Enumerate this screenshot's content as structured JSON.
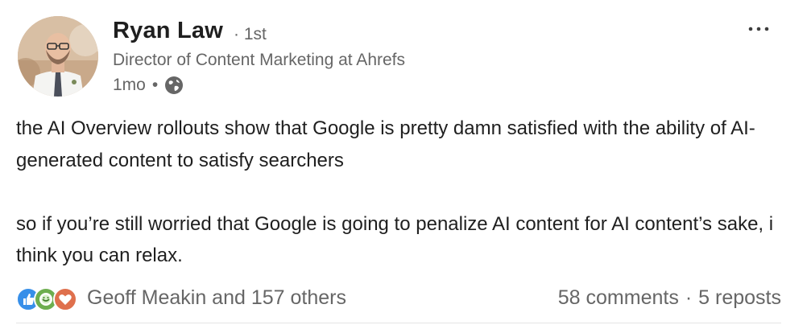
{
  "author": {
    "name": "Ryan Law",
    "degree": "· 1st",
    "headline": "Director of Content Marketing at Ahrefs",
    "time": "1mo",
    "time_separator": "•"
  },
  "post": {
    "paragraphs": [
      "the AI Overview rollouts show that Google is pretty damn satisfied with the ability of AI-generated content to satisfy searchers",
      "so if you’re still worried that Google is going to penalize AI content for AI content’s sake, i think you can relax."
    ]
  },
  "social": {
    "reactors_text": "Geoff Meakin and 157 others",
    "comments": "58 comments",
    "separator": "·",
    "reposts": "5 reposts",
    "reaction_icons": [
      "like-icon",
      "celebrate-icon",
      "love-icon"
    ]
  },
  "colors": {
    "like": "#378fe9",
    "celebrate": "#6dae4f",
    "love": "#df704d",
    "secondary_text": "#666666",
    "primary_text": "#1f1f1f"
  }
}
